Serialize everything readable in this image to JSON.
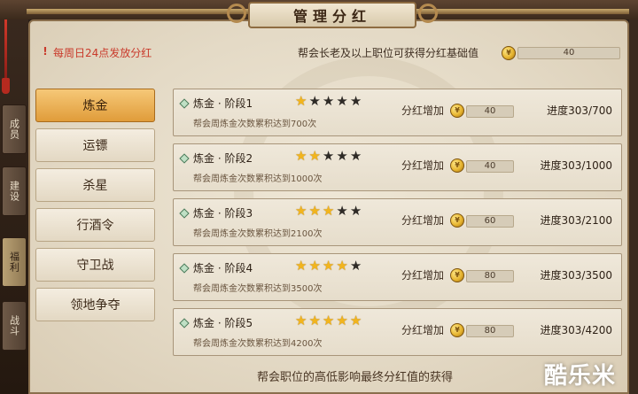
{
  "window": {
    "title": "管理分红"
  },
  "side_tabs": [
    "成员",
    "建设",
    "福利",
    "战斗"
  ],
  "header": {
    "notice": "每周日24点发放分红",
    "base_label": "帮会长老及以上职位可获得分红基础值",
    "base_value": "40"
  },
  "categories": [
    {
      "label": "炼金",
      "active": true
    },
    {
      "label": "运镖",
      "active": false
    },
    {
      "label": "杀星",
      "active": false
    },
    {
      "label": "行酒令",
      "active": false
    },
    {
      "label": "守卫战",
      "active": false
    },
    {
      "label": "领地争夺",
      "active": false
    }
  ],
  "bonus_label": "分红增加",
  "stages": [
    {
      "title": "炼金 · 阶段1",
      "desc": "帮会周炼金次数累积达到700次",
      "stars_filled": 1,
      "stars_total": 5,
      "bonus": "40",
      "progress": "进度303/700"
    },
    {
      "title": "炼金 · 阶段2",
      "desc": "帮会周炼金次数累积达到1000次",
      "stars_filled": 2,
      "stars_total": 5,
      "bonus": "40",
      "progress": "进度303/1000"
    },
    {
      "title": "炼金 · 阶段3",
      "desc": "帮会周炼金次数累积达到2100次",
      "stars_filled": 3,
      "stars_total": 5,
      "bonus": "60",
      "progress": "进度303/2100"
    },
    {
      "title": "炼金 · 阶段4",
      "desc": "帮会周炼金次数累积达到3500次",
      "stars_filled": 4,
      "stars_total": 5,
      "bonus": "80",
      "progress": "进度303/3500"
    },
    {
      "title": "炼金 · 阶段5",
      "desc": "帮会周炼金次数累积达到4200次",
      "stars_filled": 5,
      "stars_total": 5,
      "bonus": "80",
      "progress": "进度303/4200"
    }
  ],
  "footer": "帮会职位的高低影响最终分红值的获得",
  "watermark": "酷乐米",
  "icons": {
    "notice": "exclamation-icon",
    "coin": "gold-coin-icon",
    "star": "star-icon"
  },
  "colors": {
    "accent": "#e09c3a",
    "notice": "#c93a2b",
    "star_on": "#f2b51d",
    "star_off": "#2e2a26"
  }
}
